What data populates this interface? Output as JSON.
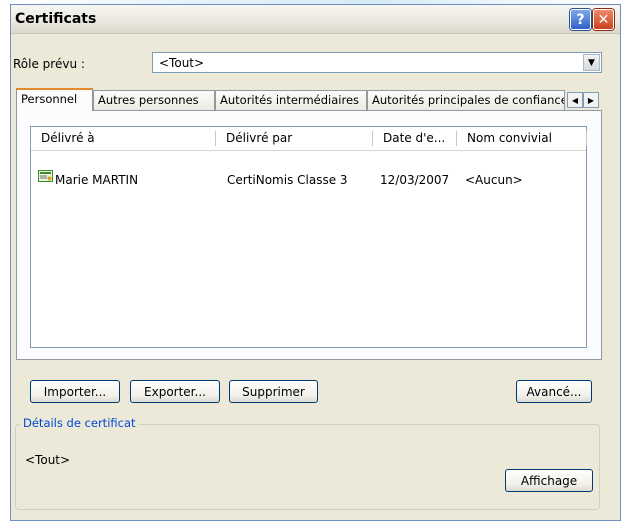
{
  "window": {
    "title": "Certificats"
  },
  "role": {
    "label": "Rôle prévu :",
    "value": "<Tout>"
  },
  "tabs": [
    {
      "label": "Personnel"
    },
    {
      "label": "Autres personnes"
    },
    {
      "label": "Autorités intermédiaires"
    },
    {
      "label": "Autorités principales de confiance"
    }
  ],
  "list": {
    "columns": [
      "Délivré à",
      "Délivré par",
      "Date d'e...",
      "Nom convivial"
    ],
    "rows": [
      [
        "Marie MARTIN",
        "CertiNomis Classe 3",
        "12/03/2007",
        "<Aucun>"
      ]
    ]
  },
  "buttons": {
    "import": "Importer...",
    "export": "Exporter...",
    "remove": "Supprimer",
    "advanced": "Avancé...",
    "view": "Affichage"
  },
  "details": {
    "title": "Détails de certificat",
    "value": "<Tout>"
  },
  "icons": {
    "help": "help-icon",
    "close": "close-icon",
    "dropdown": "chevron-down-icon",
    "certificate": "certificate-icon"
  },
  "colors": {
    "accent_tab": "#e68b2c",
    "group_title": "#0046d5",
    "close_red": "#c8401e",
    "help_blue": "#2f62c8"
  }
}
